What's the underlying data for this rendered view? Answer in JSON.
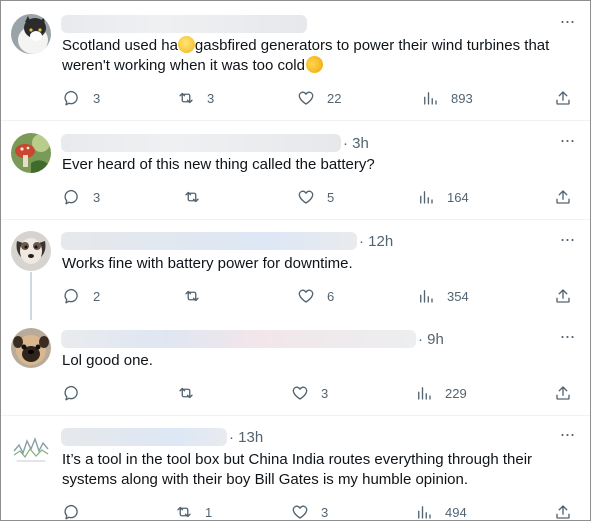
{
  "tweets": [
    {
      "time": "",
      "text_line1_a": "Scotland used ha",
      "text_line1_b": "gasbfired generators to power their wind turbines that",
      "text_line2": "weren't working when it was too cold",
      "replies": "3",
      "reposts": "3",
      "likes": "22",
      "views": "893",
      "avatar_icon": "cat-avatar"
    },
    {
      "time": "· 3h",
      "text_line1": "Ever heard of this new thing called the battery?",
      "replies": "3",
      "reposts": "",
      "likes": "5",
      "views": "164",
      "avatar_icon": "mushroom-avatar"
    },
    {
      "time": "· 12h",
      "text_line1": "Works fine with battery power for downtime.",
      "replies": "2",
      "reposts": "",
      "likes": "6",
      "views": "354",
      "avatar_icon": "dog-avatar"
    },
    {
      "time": "· 9h",
      "text_line1": "Lol good one.",
      "replies": "",
      "reposts": "",
      "likes": "3",
      "views": "229",
      "avatar_icon": "pug-avatar"
    },
    {
      "time": "· 13h",
      "text_line1": "It’s a tool in the tool box but China India routes everything through their",
      "text_line2": "systems along with their boy Bill Gates is my humble opinion.",
      "replies": "",
      "reposts": "1",
      "likes": "3",
      "views": "494",
      "avatar_icon": "chart-avatar"
    }
  ],
  "more_icon": "···",
  "colors": {
    "text": "#0f1419",
    "muted": "#536471",
    "divider": "#eff3f4"
  }
}
